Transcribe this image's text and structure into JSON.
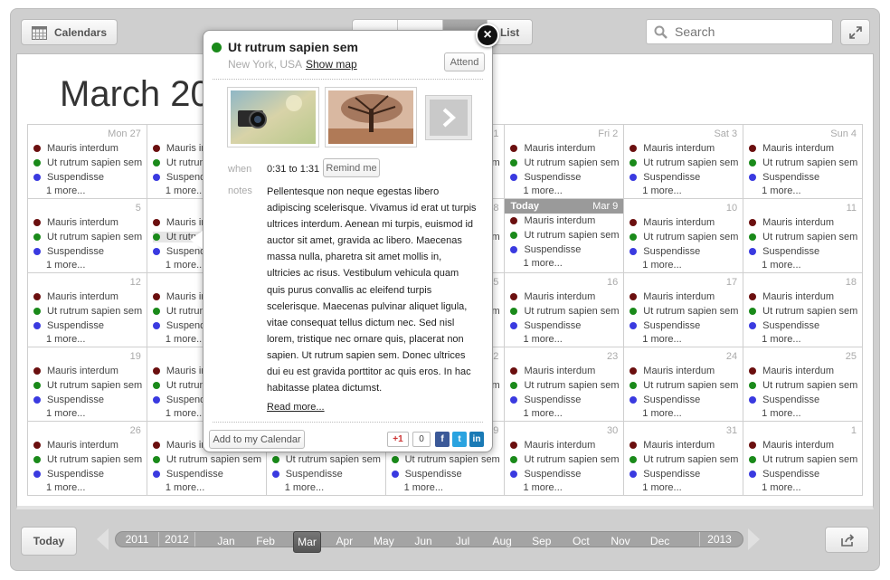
{
  "toolbar": {
    "calendars_label": "Calendars",
    "views": [
      "",
      "",
      "",
      "List"
    ],
    "active_view_index": 2,
    "search_placeholder": "Search"
  },
  "calendar": {
    "title": "March 20",
    "today_label": "Today",
    "colors": {
      "maroon": "#6b0f0f",
      "green": "#1a8a1a",
      "blue": "#3a3ae0"
    },
    "events": [
      {
        "label": "Mauris interdum",
        "color": "maroon"
      },
      {
        "label": "Ut rutrum sapien sem",
        "color": "green"
      },
      {
        "label": "Suspendisse",
        "color": "blue"
      }
    ],
    "more_label": "1 more...",
    "weeks": [
      [
        "Mon 27",
        "",
        "",
        "1",
        "Fri 2",
        "Sat 3",
        "Sun 4"
      ],
      [
        "5",
        "",
        "",
        "8",
        "Mar 9",
        "10",
        "11"
      ],
      [
        "12",
        "",
        "",
        "15",
        "16",
        "17",
        "18"
      ],
      [
        "19",
        "",
        "",
        "22",
        "23",
        "24",
        "25"
      ],
      [
        "26",
        "",
        "",
        "29",
        "30",
        "31",
        "1"
      ]
    ]
  },
  "popup": {
    "title": "Ut rutrum sapien sem",
    "location": "New York, USA",
    "show_map": "Show map",
    "attend": "Attend",
    "when_label": "when",
    "when_value": "0:31 to 1:31",
    "remind": "Remind me",
    "notes_label": "notes",
    "notes": "Pellentesque non neque egestas libero adipiscing scelerisque. Vivamus id erat ut turpis ultrices interdum. Aenean mi turpis, euismod id auctor sit amet, gravida ac libero. Maecenas massa nulla, pharetra sit amet mollis in, ultricies ac risus. Vestibulum vehicula quam quis purus convallis ac eleifend turpis scelerisque. Maecenas pulvinar aliquet ligula, vitae consequat tellus dictum nec. Sed nisl lorem, tristique nec ornare quis, placerat non sapien. Ut rutrum sapien sem. Donec ultrices dui eu est gravida porttitor ac quis eros. In hac habitasse platea dictumst.",
    "read_more": "Read more...",
    "add_to_calendar": "Add to my Calendar",
    "gplus": "+1",
    "gplus_count": "0",
    "fb": "f",
    "tw": "t",
    "li": "in",
    "close": "×"
  },
  "bottom": {
    "today": "Today",
    "years_before": [
      "2011",
      "2012"
    ],
    "months": [
      "Jan",
      "Feb",
      "Mar",
      "Apr",
      "May",
      "Jun",
      "Jul",
      "Aug",
      "Sep",
      "Oct",
      "Nov",
      "Dec"
    ],
    "active_month": "Mar",
    "year_after": "2013"
  }
}
